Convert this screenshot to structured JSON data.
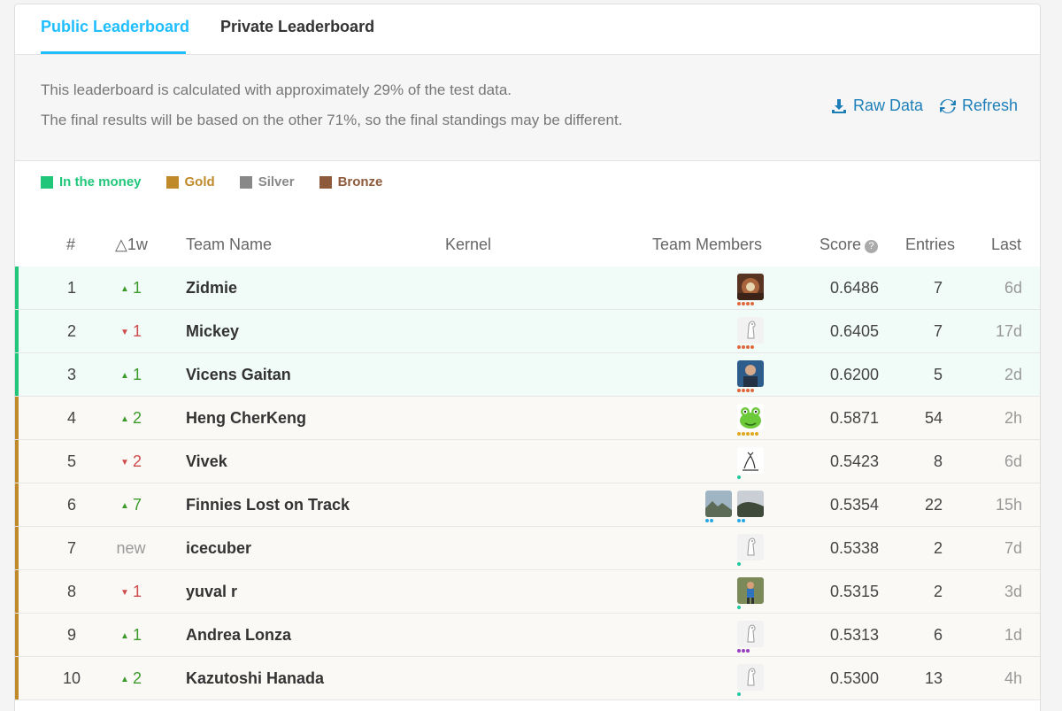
{
  "tabs": {
    "public": "Public Leaderboard",
    "private": "Private Leaderboard"
  },
  "info": {
    "line1": "This leaderboard is calculated with approximately 29% of the test data.",
    "line2": "The final results will be based on the other 71%, so the final standings may be different.",
    "raw_data": "Raw Data",
    "refresh": "Refresh"
  },
  "legend": [
    {
      "label": "In the money",
      "color": "#20c77a"
    },
    {
      "label": "Gold",
      "color": "#c08a2a"
    },
    {
      "label": "Silver",
      "color": "#888888"
    },
    {
      "label": "Bronze",
      "color": "#8e5a3c"
    }
  ],
  "columns": {
    "rank": "#",
    "delta": "△1w",
    "team": "Team Name",
    "kernel": "Kernel",
    "members": "Team Members",
    "score": "Score",
    "entries": "Entries",
    "last": "Last"
  },
  "rows": [
    {
      "rank": "1",
      "delta": "1",
      "dir": "up",
      "team": "Zidmie",
      "score": "0.6486",
      "entries": "7",
      "last": "6d",
      "tier": "money",
      "avatars": [
        "photo-dark"
      ],
      "dots": [
        "#e0683c",
        "#e0683c",
        "#e0683c",
        "#e0683c"
      ]
    },
    {
      "rank": "2",
      "delta": "1",
      "dir": "down",
      "team": "Mickey",
      "score": "0.6405",
      "entries": "7",
      "last": "17d",
      "tier": "money",
      "avatars": [
        "default"
      ],
      "dots": [
        "#e0683c",
        "#e0683c",
        "#e0683c",
        "#e0683c"
      ]
    },
    {
      "rank": "3",
      "delta": "1",
      "dir": "up",
      "team": "Vicens Gaitan",
      "score": "0.6200",
      "entries": "5",
      "last": "2d",
      "tier": "money",
      "avatars": [
        "photo-blue"
      ],
      "dots": [
        "#e0683c",
        "#e0683c",
        "#e0683c",
        "#e0683c"
      ]
    },
    {
      "rank": "4",
      "delta": "2",
      "dir": "up",
      "team": "Heng CherKeng",
      "score": "0.5871",
      "entries": "54",
      "last": "2h",
      "tier": "gold",
      "avatars": [
        "frog"
      ],
      "dots": [
        "#e0a81e",
        "#e0a81e",
        "#e0a81e",
        "#e0a81e",
        "#e0a81e"
      ]
    },
    {
      "rank": "5",
      "delta": "2",
      "dir": "down",
      "team": "Vivek",
      "score": "0.5423",
      "entries": "8",
      "last": "6d",
      "tier": "gold",
      "avatars": [
        "sketch"
      ],
      "dots": [
        "#20c7a0"
      ]
    },
    {
      "rank": "6",
      "delta": "7",
      "dir": "up",
      "team": "Finnies Lost on Track",
      "score": "0.5354",
      "entries": "22",
      "last": "15h",
      "tier": "gold",
      "avatars": [
        "photo-land",
        "photo-hill"
      ],
      "dots": [
        "#2aa7e0",
        "#2aa7e0"
      ]
    },
    {
      "rank": "7",
      "delta": "new",
      "dir": "new",
      "team": "icecuber",
      "score": "0.5338",
      "entries": "2",
      "last": "7d",
      "tier": "gold",
      "avatars": [
        "default"
      ],
      "dots": [
        "#20c7a0"
      ]
    },
    {
      "rank": "8",
      "delta": "1",
      "dir": "down",
      "team": "yuval r",
      "score": "0.5315",
      "entries": "2",
      "last": "3d",
      "tier": "gold",
      "avatars": [
        "photo-run"
      ],
      "dots": [
        "#20c7a0"
      ]
    },
    {
      "rank": "9",
      "delta": "1",
      "dir": "up",
      "team": "Andrea Lonza",
      "score": "0.5313",
      "entries": "6",
      "last": "1d",
      "tier": "gold",
      "avatars": [
        "default"
      ],
      "dots": [
        "#9b3fbf",
        "#9b3fbf",
        "#9b3fbf"
      ]
    },
    {
      "rank": "10",
      "delta": "2",
      "dir": "up",
      "team": "Kazutoshi Hanada",
      "score": "0.5300",
      "entries": "13",
      "last": "4h",
      "tier": "gold",
      "avatars": [
        "default"
      ],
      "dots": [
        "#20c7a0"
      ]
    }
  ],
  "colors": {
    "accent": "#20beff",
    "link": "#1e7fb8",
    "money": "#20c77a",
    "gold": "#c08a2a",
    "silver": "#888888",
    "up": "#3c9a2a",
    "down": "#d04b4b"
  }
}
